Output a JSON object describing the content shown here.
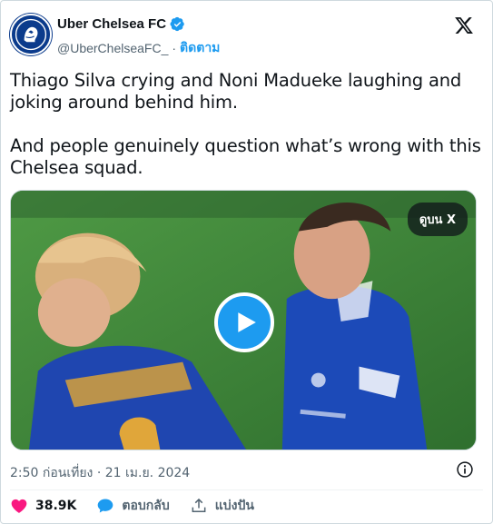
{
  "account": {
    "name": "Uber Chelsea FC",
    "handle": "@UberChelseaFC_",
    "separator": "·",
    "follow_label": "ติดตาม"
  },
  "tweet": {
    "paragraph1": "Thiago Silva crying and Noni Madueke laughing and joking around behind him.",
    "paragraph2": "And people genuinely question what’s wrong with this Chelsea squad."
  },
  "media": {
    "watch_label": "ดูบน X"
  },
  "meta": {
    "timestamp": "2:50 ก่อนเที่ยง · 21 เม.ย. 2024"
  },
  "actions": {
    "likes": "38.9K",
    "reply_label": "ตอบกลับ",
    "share_label": "แบ่งปัน"
  },
  "colors": {
    "accent": "#1d9bf0",
    "like": "#f91880",
    "muted": "#536471",
    "chelsea_blue": "#0b3b8c"
  }
}
